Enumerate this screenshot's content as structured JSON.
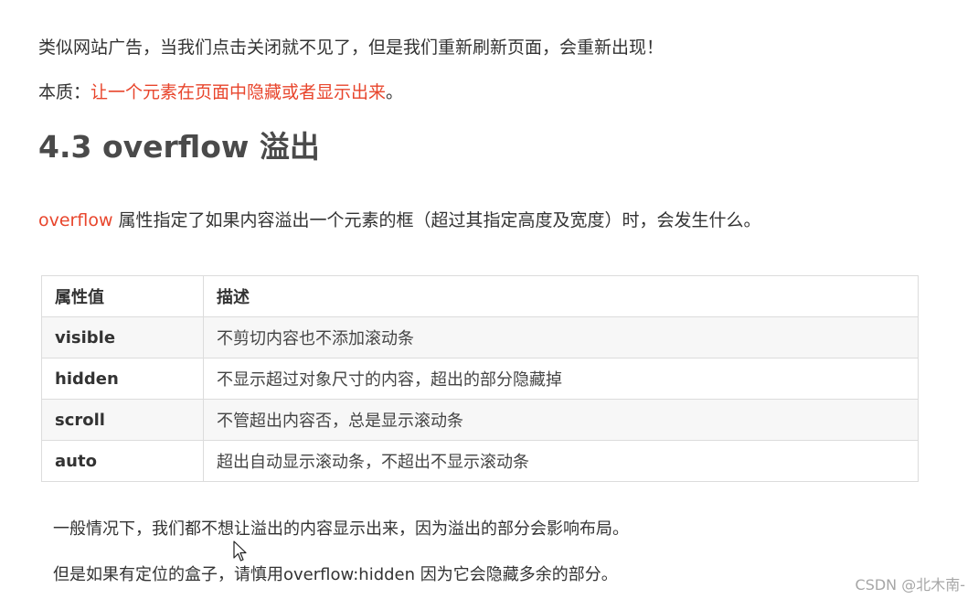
{
  "intro": "类似网站广告，当我们点击关闭就不见了，但是我们重新刷新页面，会重新出现！",
  "essence": {
    "label": "本质：",
    "highlight": "让一个元素在页面中隐藏或者显示出来",
    "end": "。"
  },
  "heading": "4.3 overflow 溢出",
  "description": {
    "keyword": "overflow",
    "text": " 属性指定了如果内容溢出一个元素的框（超过其指定高度及宽度）时，会发生什么。"
  },
  "table": {
    "headers": [
      "属性值",
      "描述"
    ],
    "rows": [
      {
        "value": "visible",
        "desc": "不剪切内容也不添加滚动条"
      },
      {
        "value": "hidden",
        "desc": "不显示超过对象尺寸的内容，超出的部分隐藏掉"
      },
      {
        "value": "scroll",
        "desc": "不管超出内容否，总是显示滚动条"
      },
      {
        "value": "auto",
        "desc": "超出自动显示滚动条，不超出不显示滚动条"
      }
    ]
  },
  "notes": [
    "一般情况下，我们都不想让溢出的内容显示出来，因为溢出的部分会影响布局。",
    "但是如果有定位的盒子，请慎用overflow:hidden 因为它会隐藏多余的部分。"
  ],
  "watermark": "CSDN @北木南-",
  "colors": {
    "accent_red": "#e8452c",
    "heading": "#4a4a4a",
    "text": "#333333",
    "table_border": "#dcdcdc",
    "row_stripe": "#f7f7f7"
  },
  "icons": {
    "cursor": "mouse-pointer-icon"
  }
}
